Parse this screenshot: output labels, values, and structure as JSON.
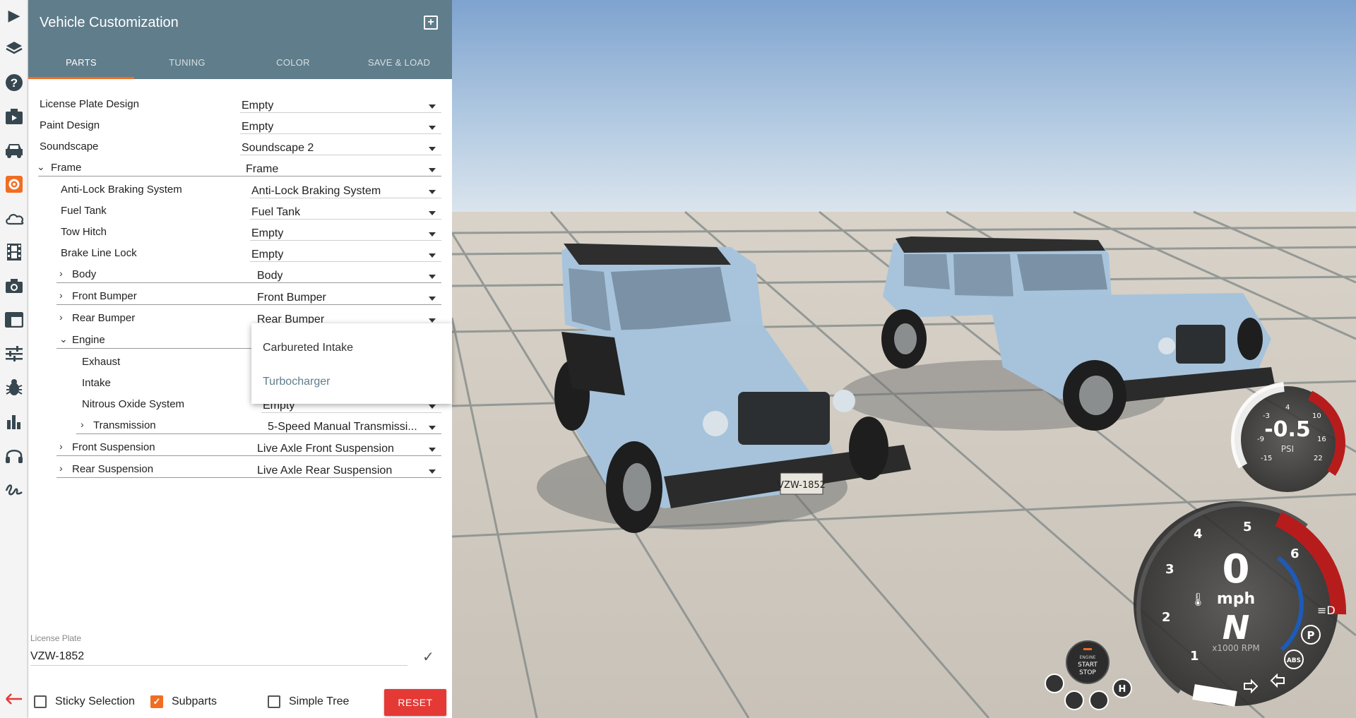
{
  "sidebar": {
    "icons": [
      "play-icon",
      "layers-icon",
      "help-icon",
      "media-icon",
      "car-icon",
      "gear-icon",
      "cloud-icon",
      "film-icon",
      "camera-icon",
      "window-icon",
      "sliders-icon",
      "bug-icon",
      "bar-chart-icon",
      "headphones-icon",
      "signature-icon"
    ],
    "active_icon": "gear-icon",
    "back_icon": "arrow-left-icon",
    "accent": "#f06d22"
  },
  "panel": {
    "title": "Vehicle Customization",
    "header_color": "#607d8b",
    "tabs": [
      {
        "label": "PARTS",
        "active": true
      },
      {
        "label": "TUNING",
        "active": false
      },
      {
        "label": "COLOR",
        "active": false
      },
      {
        "label": "SAVE & LOAD",
        "active": false
      }
    ]
  },
  "parts": [
    {
      "label": "License Plate Design",
      "value": "Empty"
    },
    {
      "label": "Paint Design",
      "value": "Empty"
    },
    {
      "label": "Soundscape",
      "value": "Soundscape 2"
    },
    {
      "label": "Frame",
      "value": "Frame",
      "expanded": true
    },
    {
      "label": "Anti-Lock Braking System",
      "value": "Anti-Lock Braking System"
    },
    {
      "label": "Fuel Tank",
      "value": "Fuel Tank"
    },
    {
      "label": "Tow Hitch",
      "value": "Empty"
    },
    {
      "label": "Brake Line Lock",
      "value": "Empty"
    },
    {
      "label": "Body",
      "value": "Body",
      "expanded": false
    },
    {
      "label": "Front Bumper",
      "value": "Front Bumper",
      "expanded": false
    },
    {
      "label": "Rear Bumper",
      "value": "Rear Bumper",
      "expanded": false
    },
    {
      "label": "Engine",
      "value": "",
      "expanded": true
    },
    {
      "label": "Exhaust",
      "value": ""
    },
    {
      "label": "Intake",
      "value": ""
    },
    {
      "label": "Nitrous Oxide System",
      "value": "Empty"
    },
    {
      "label": "Transmission",
      "value": "5-Speed Manual Transmissi...",
      "expanded": false
    },
    {
      "label": "Front Suspension",
      "value": "Live Axle Front Suspension",
      "expanded": false
    },
    {
      "label": "Rear Suspension",
      "value": "Live Axle Rear Suspension",
      "expanded": false
    }
  ],
  "dropdown": {
    "options": [
      "Carbureted Intake",
      "Turbocharger"
    ],
    "highlighted": "Turbocharger"
  },
  "license_plate": {
    "label": "License Plate",
    "value": "VZW-1852"
  },
  "footer": {
    "sticky_selection": {
      "label": "Sticky Selection",
      "checked": false
    },
    "subparts": {
      "label": "Subparts",
      "checked": true
    },
    "simple_tree": {
      "label": "Simple Tree",
      "checked": false
    },
    "reset_label": "RESET"
  },
  "hud": {
    "boost_value": "-0.5",
    "boost_unit": "PSI",
    "boost_ticks": [
      "-3",
      "4",
      "10",
      "-9",
      "16",
      "-15",
      "22"
    ],
    "speed_value": "0",
    "speed_unit": "mph",
    "gear": "N",
    "rpm_unit": "x1000 RPM",
    "rpm_ticks": [
      "1",
      "2",
      "3",
      "4",
      "5",
      "6"
    ],
    "engine_button": {
      "line1": "ENGINE",
      "line2": "START",
      "line3": "STOP"
    },
    "abs_label": "ABS",
    "park_label": "P",
    "handbrake_label": "H",
    "plate_text": "VZW-1852"
  }
}
